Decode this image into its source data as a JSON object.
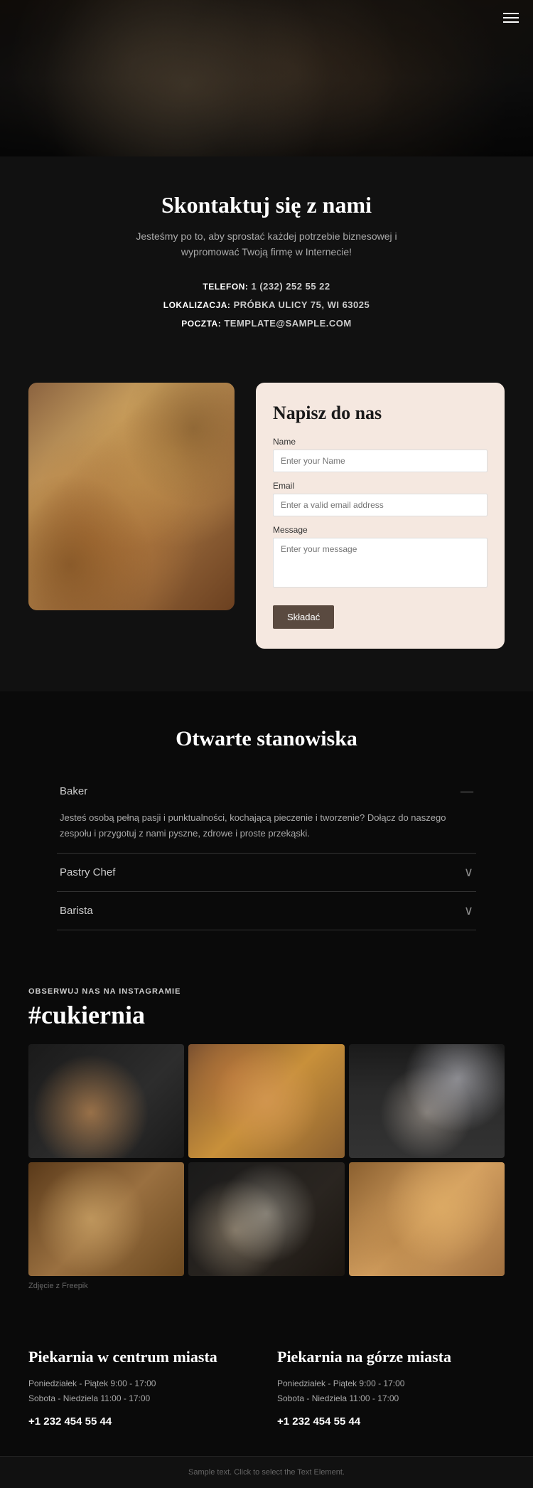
{
  "hero": {
    "alt": "Baker kneading dough"
  },
  "menu": {
    "icon_label": "menu"
  },
  "contact": {
    "heading": "Skontaktuj się z nami",
    "subtitle_line1": "Jesteśmy po to, aby sprostać każdej potrzebie biznesowej i",
    "subtitle_line2": "wypromować Twoją firmę w Internecie!",
    "phone_label": "TELEFON:",
    "phone_value": "1 (232) 252 55 22",
    "location_label": "LOKALIZACJA:",
    "location_value": "PRÓBKA ULICY 75, WI 63025",
    "email_label": "POCZTA:",
    "email_value": "TEMPLATE@SAMPLE.COM"
  },
  "form": {
    "heading": "Napisz do nas",
    "name_label": "Name",
    "name_placeholder": "Enter your Name",
    "email_label": "Email",
    "email_placeholder": "Enter a valid email address",
    "message_label": "Message",
    "message_placeholder": "Enter your message",
    "submit_label": "Składać"
  },
  "jobs": {
    "heading": "Otwarte stanowiska",
    "items": [
      {
        "title": "Baker",
        "expanded": true,
        "description": "Jesteś osobą pełną pasji i punktualności, kochającą pieczenie i tworzenie? Dołącz do naszego zespołu i przygotuj z nami pyszne, zdrowe i proste przekąski.",
        "icon": "—"
      },
      {
        "title": "Pastry Chef",
        "expanded": false,
        "icon": "∨"
      },
      {
        "title": "Barista",
        "expanded": false,
        "icon": "∨"
      }
    ]
  },
  "instagram": {
    "label": "OBSERWUJ NAS NA INSTAGRAMIE",
    "tag": "#cukiernia",
    "credit": "Zdjęcie z Freepik"
  },
  "locations": [
    {
      "name": "Piekarnia w centrum miasta",
      "hours_weekday": "Poniedziałek - Piątek 9:00 - 17:00",
      "hours_weekend": "Sobota - Niedziela 11:00 - 17:00",
      "phone": "+1 232 454 55 44"
    },
    {
      "name": "Piekarnia na górze miasta",
      "hours_weekday": "Poniedziałek - Piątek 9:00 - 17:00",
      "hours_weekend": "Sobota - Niedziela 11:00 - 17:00",
      "phone": "+1 232 454 55 44"
    }
  ],
  "footer": {
    "text": "Sample text. Click to select the Text Element."
  }
}
